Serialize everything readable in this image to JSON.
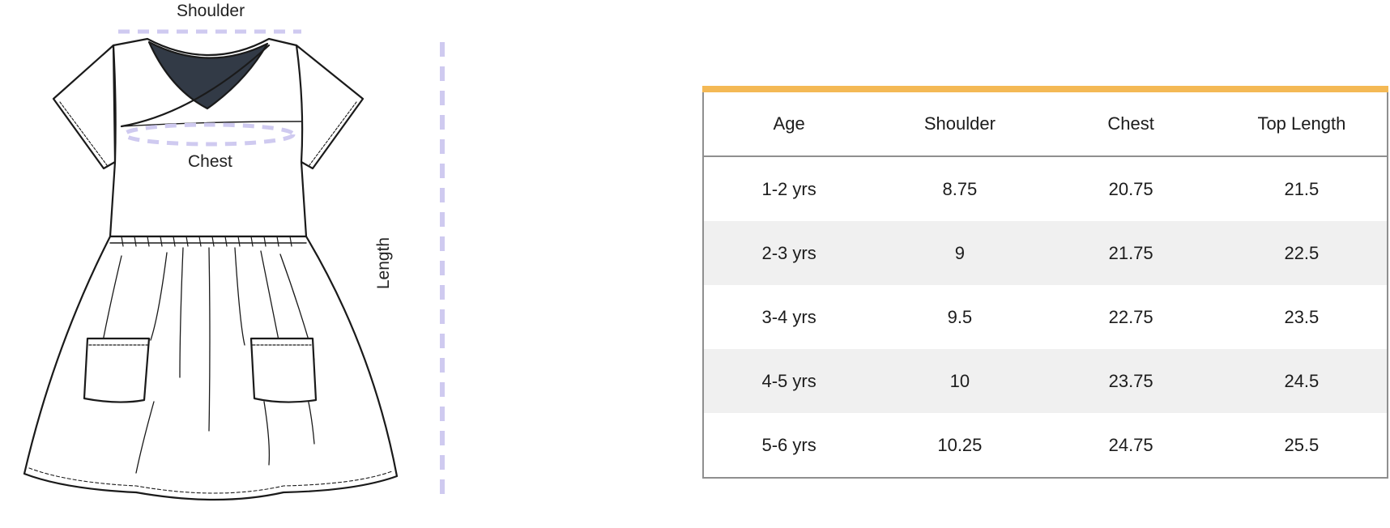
{
  "diagram": {
    "labels": {
      "shoulder": "Shoulder",
      "chest": "Chest",
      "length": "Length"
    },
    "colors": {
      "measure_guide": "#cfcaf0",
      "neck_fill": "#323a46",
      "outline": "#1a1a1a"
    }
  },
  "size_table": {
    "accent_color": "#f4b955",
    "headers": [
      "Age",
      "Shoulder",
      "Chest",
      "Top Length"
    ],
    "rows": [
      [
        "1-2 yrs",
        "8.75",
        "20.75",
        "21.5"
      ],
      [
        "2-3 yrs",
        "9",
        "21.75",
        "22.5"
      ],
      [
        "3-4 yrs",
        "9.5",
        "22.75",
        "23.5"
      ],
      [
        "4-5 yrs",
        "10",
        "23.75",
        "24.5"
      ],
      [
        "5-6 yrs",
        "10.25",
        "24.75",
        "25.5"
      ]
    ]
  }
}
